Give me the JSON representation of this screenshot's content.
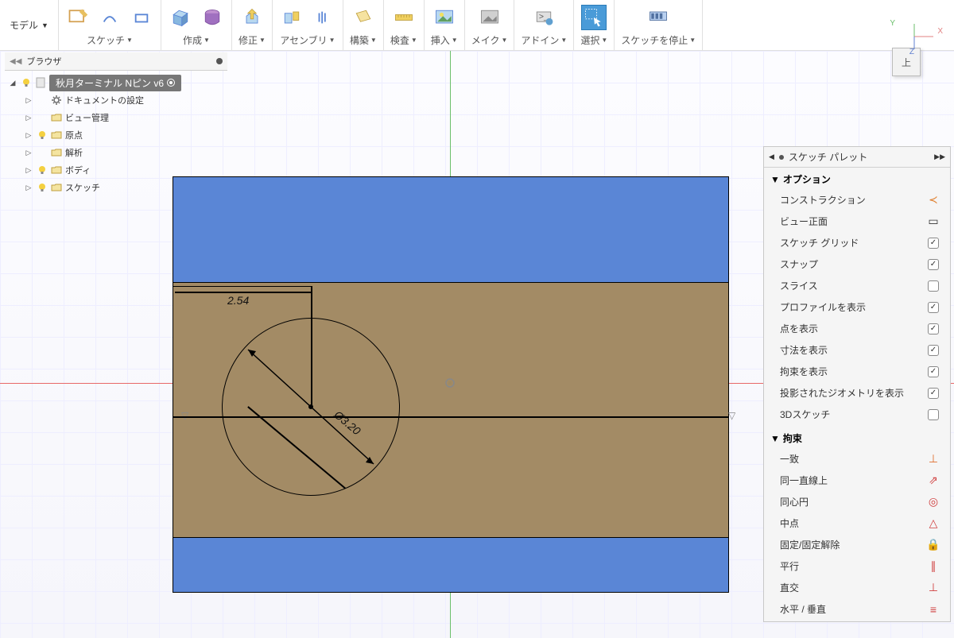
{
  "toolbar": {
    "model_label": "モデル",
    "groups": {
      "sketch": "スケッチ",
      "create": "作成",
      "modify": "修正",
      "assembly": "アセンブリ",
      "construct": "構築",
      "inspect": "検査",
      "insert": "挿入",
      "make": "メイク",
      "addin": "アドイン",
      "select": "選択",
      "stop_sketch": "スケッチを停止"
    }
  },
  "browser": {
    "title": "ブラウザ",
    "doc_name": "秋月ターミナル Nピン v6",
    "items": [
      {
        "icon": "gear",
        "label": "ドキュメントの設定",
        "bulb": false
      },
      {
        "icon": "folder",
        "label": "ビュー管理",
        "bulb": false
      },
      {
        "icon": "folder",
        "label": "原点",
        "bulb": true
      },
      {
        "icon": "folder",
        "label": "解析",
        "bulb": false
      },
      {
        "icon": "folder",
        "label": "ボディ",
        "bulb": true
      },
      {
        "icon": "folder",
        "label": "スケッチ",
        "bulb": true
      }
    ]
  },
  "viewcube": {
    "face": "上",
    "axis_x": "X",
    "axis_y": "Y",
    "axis_z": "Z"
  },
  "sketch": {
    "dim_horizontal": "2.54",
    "dim_diameter": "Ø3.20"
  },
  "palette": {
    "title": "スケッチ パレット",
    "section_options": "オプション",
    "section_constraints": "拘束",
    "options": [
      {
        "label": "コンストラクション",
        "type": "glyph",
        "glyph": "≺",
        "cls": "orange"
      },
      {
        "label": "ビュー正面",
        "type": "glyph",
        "glyph": "▭",
        "cls": ""
      },
      {
        "label": "スケッチ グリッド",
        "type": "check",
        "on": true
      },
      {
        "label": "スナップ",
        "type": "check",
        "on": true
      },
      {
        "label": "スライス",
        "type": "check",
        "on": false
      },
      {
        "label": "プロファイルを表示",
        "type": "check",
        "on": true
      },
      {
        "label": "点を表示",
        "type": "check",
        "on": true
      },
      {
        "label": "寸法を表示",
        "type": "check",
        "on": true
      },
      {
        "label": "拘束を表示",
        "type": "check",
        "on": true
      },
      {
        "label": "投影されたジオメトリを表示",
        "type": "check",
        "on": true
      },
      {
        "label": "3Dスケッチ",
        "type": "check",
        "on": false
      }
    ],
    "constraints": [
      {
        "label": "一致",
        "glyph": "⊥",
        "cls": "g-coincident"
      },
      {
        "label": "同一直線上",
        "glyph": "⇗",
        "cls": "red"
      },
      {
        "label": "同心円",
        "glyph": "◎",
        "cls": "redfill"
      },
      {
        "label": "中点",
        "glyph": "△",
        "cls": "red"
      },
      {
        "label": "固定/固定解除",
        "glyph": "🔒",
        "cls": "g-lock"
      },
      {
        "label": "平行",
        "glyph": "∥",
        "cls": "red"
      },
      {
        "label": "直交",
        "glyph": "⊥",
        "cls": "red"
      },
      {
        "label": "水平 / 垂直",
        "glyph": "≡",
        "cls": "red"
      }
    ]
  }
}
